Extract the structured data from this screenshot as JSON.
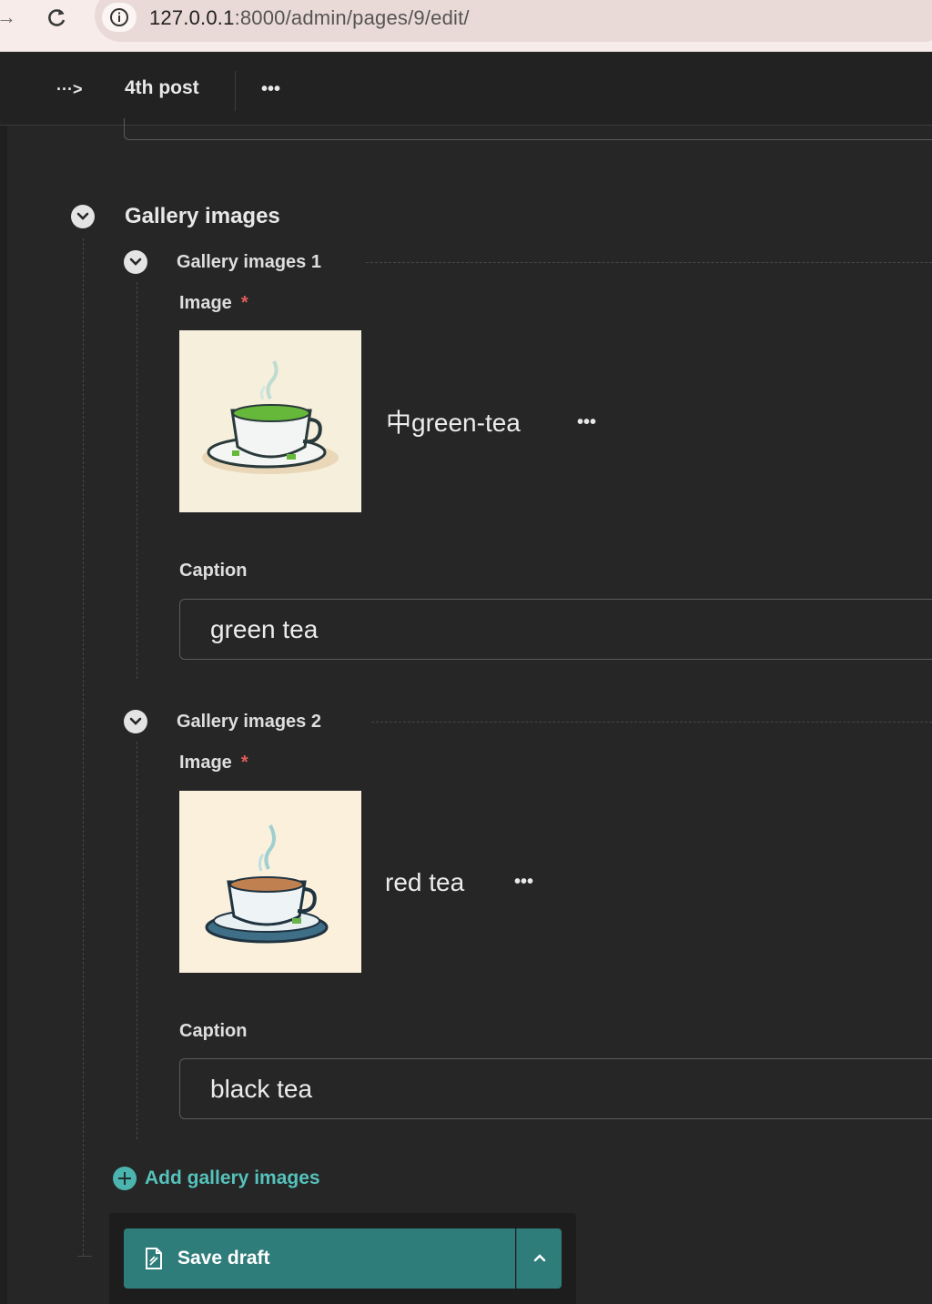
{
  "browser": {
    "url_host": "127.0.0.1",
    "url_path": ":8000/admin/pages/9/edit/"
  },
  "header": {
    "breadcrumb_toggle": "···>",
    "title": "4th post",
    "more_label": "•••"
  },
  "section": {
    "title": "Gallery images",
    "items": [
      {
        "title": "Gallery images 1",
        "image_label": "Image",
        "required_mark": "*",
        "image_name": "中green-tea",
        "image_more": "•••",
        "caption_label": "Caption",
        "caption_value": "green tea"
      },
      {
        "title": "Gallery images 2",
        "image_label": "Image",
        "required_mark": "*",
        "image_name": "red tea",
        "image_more": "•••",
        "caption_label": "Caption",
        "caption_value": "black tea"
      }
    ],
    "add_label": "Add gallery images"
  },
  "footer": {
    "save_label": "Save draft"
  },
  "colors": {
    "accent": "#2f7d7a",
    "link": "#55c2bb",
    "required": "#e25c5c",
    "background": "#262626"
  },
  "icons": {
    "reload": "reload-icon",
    "info": "info-icon",
    "chevron": "chevron-down-icon",
    "document": "document-icon",
    "caret_up": "chevron-up-icon",
    "add": "plus-circle-icon"
  }
}
